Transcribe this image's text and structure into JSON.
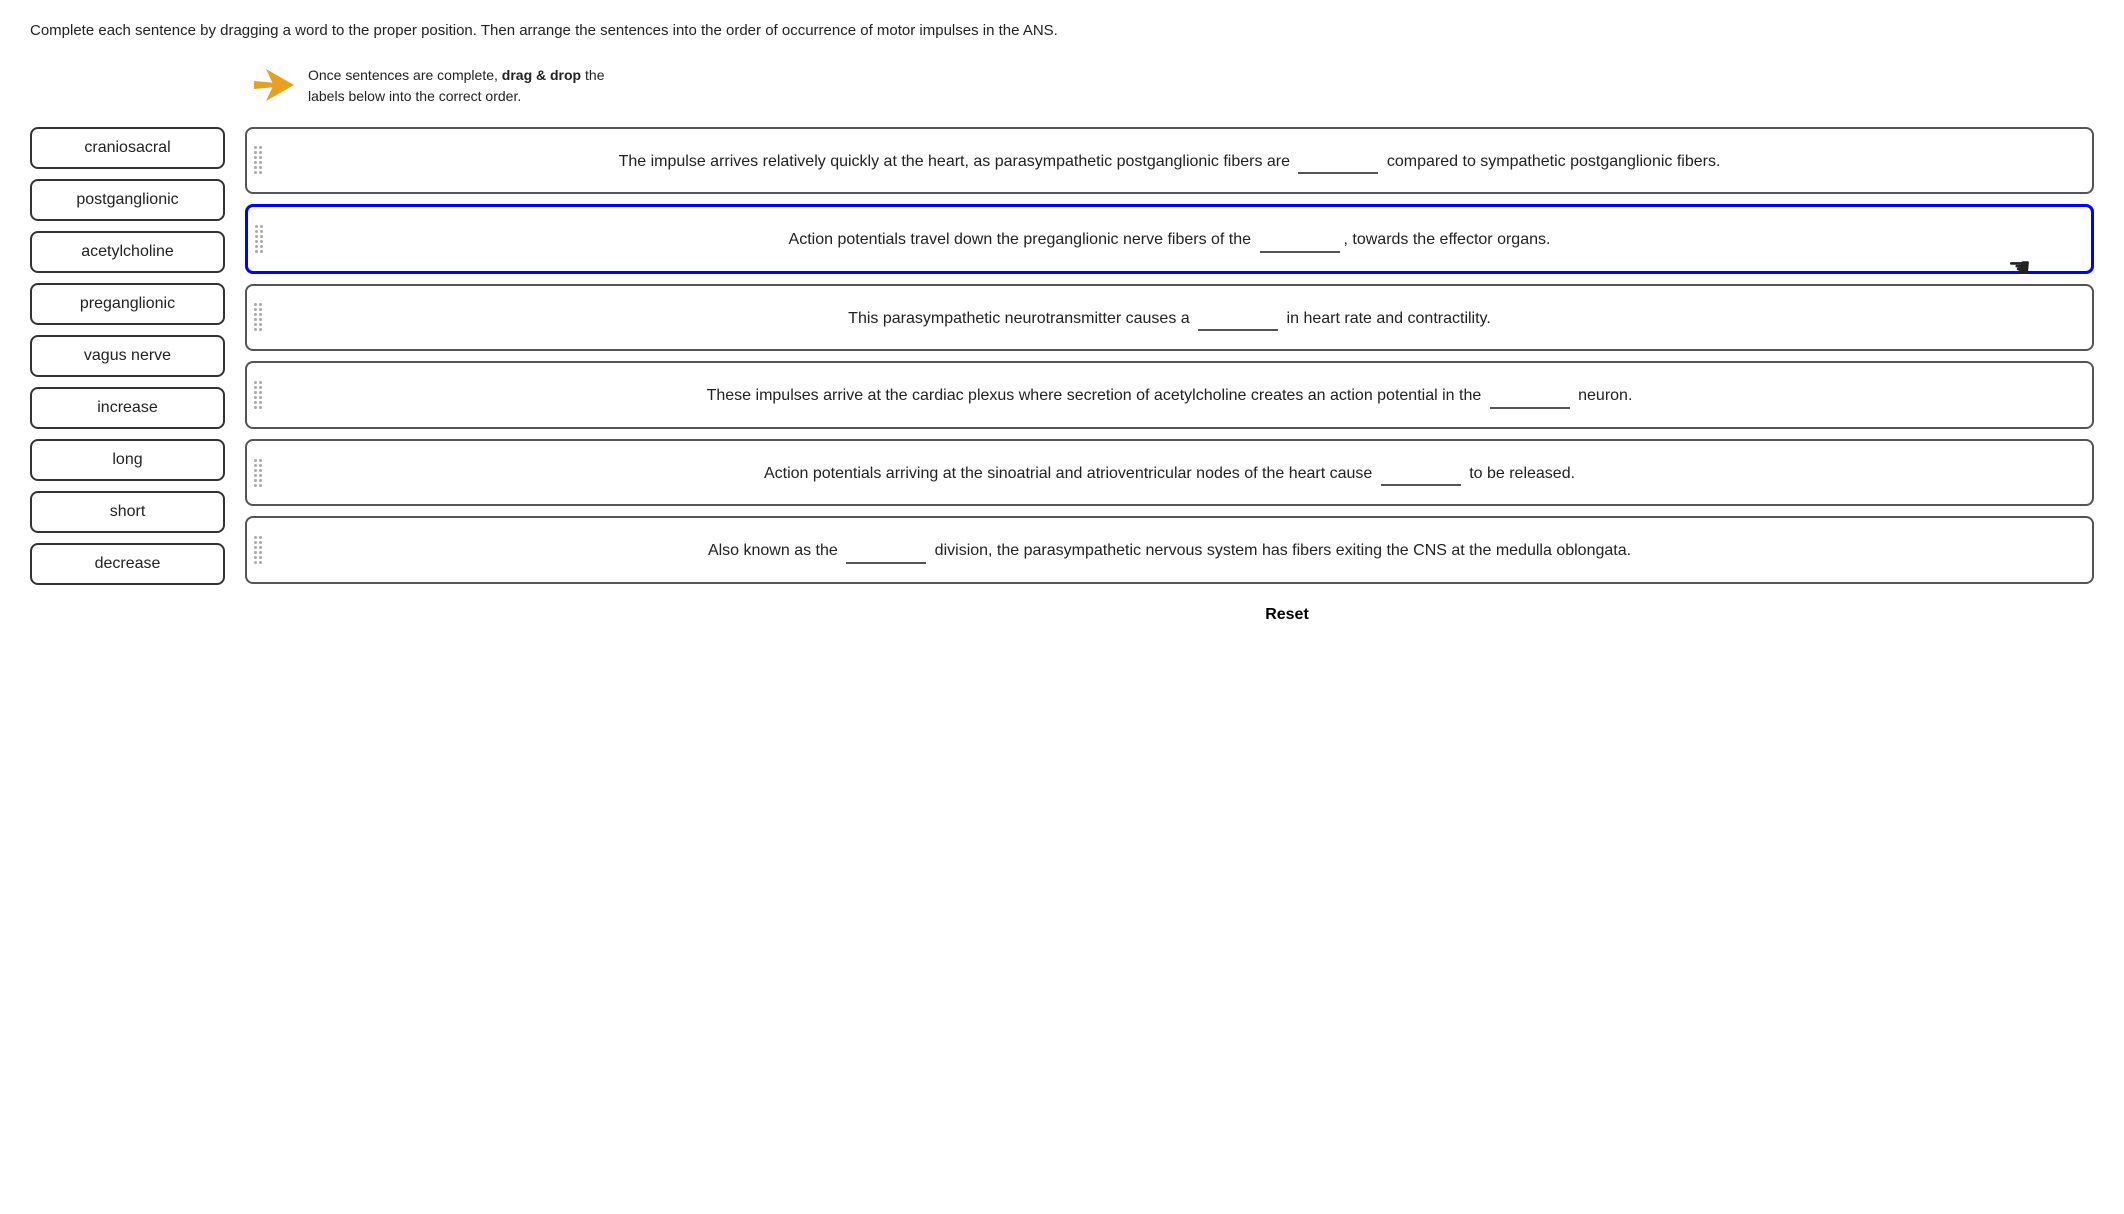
{
  "instructions": {
    "text": "Complete each sentence by dragging a word to the proper position. Then arrange the sentences into the order of occurrence of motor impulses in the ANS."
  },
  "drag_hint": {
    "text": "Once sentences are complete, drag & drop the labels below into the correct order.",
    "bold_part": "drag & drop"
  },
  "word_bank": {
    "words": [
      "craniosacral",
      "postganglionic",
      "acetylcholine",
      "preganglionic",
      "vagus nerve",
      "increase",
      "long",
      "short",
      "decrease"
    ]
  },
  "sentences": [
    {
      "id": 1,
      "text": "The impulse arrives relatively quickly at the heart, as parasympathetic postganglionic fibers are ________ compared to sympathetic postganglionic fibers.",
      "highlighted": false
    },
    {
      "id": 2,
      "text": "Action potentials travel down the preganglionic nerve fibers of the ________, towards the effector organs.",
      "highlighted": true
    },
    {
      "id": 3,
      "text": "This parasympathetic neurotransmitter causes a ________ in heart rate and contractility.",
      "highlighted": false
    },
    {
      "id": 4,
      "text": "These impulses arrive at the cardiac plexus where secretion of acetylcholine creates an action potential in the ________ neuron.",
      "highlighted": false
    },
    {
      "id": 5,
      "text": "Action potentials arriving at the sinoatrial and atrioventricular nodes of the heart cause ________ to be released.",
      "highlighted": false
    },
    {
      "id": 6,
      "text": "Also known as the ________ division, the parasympathetic nervous system has fibers exiting the CNS at the medulla oblongata.",
      "highlighted": false
    }
  ],
  "reset_label": "Reset",
  "colors": {
    "highlight_border": "#0000ff",
    "normal_border": "#555555",
    "arrow_color": "#e8a020"
  }
}
